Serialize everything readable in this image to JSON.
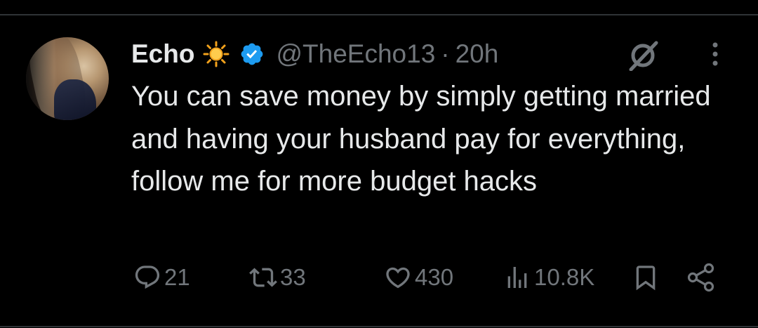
{
  "tweet": {
    "display_name": "Echo",
    "name_emoji": "sun-emoji",
    "verified": true,
    "handle": "@TheEcho13",
    "separator": "·",
    "timestamp": "20h",
    "text": "You can save money by simply getting married and having your husband pay for everything, follow me for more budget hacks"
  },
  "actions": {
    "reply_count": "21",
    "repost_count": "33",
    "like_count": "430",
    "view_count": "10.8K"
  },
  "icons": {
    "reply": "reply-icon",
    "repost": "repost-icon",
    "like": "heart-icon",
    "views": "analytics-icon",
    "bookmark": "bookmark-icon",
    "share": "share-icon",
    "grok": "grok-icon",
    "more": "more-icon"
  },
  "colors": {
    "background": "#000000",
    "text": "#e7e9ea",
    "muted": "#71767b",
    "verified": "#1d9bf0",
    "divider": "#2f3336"
  }
}
